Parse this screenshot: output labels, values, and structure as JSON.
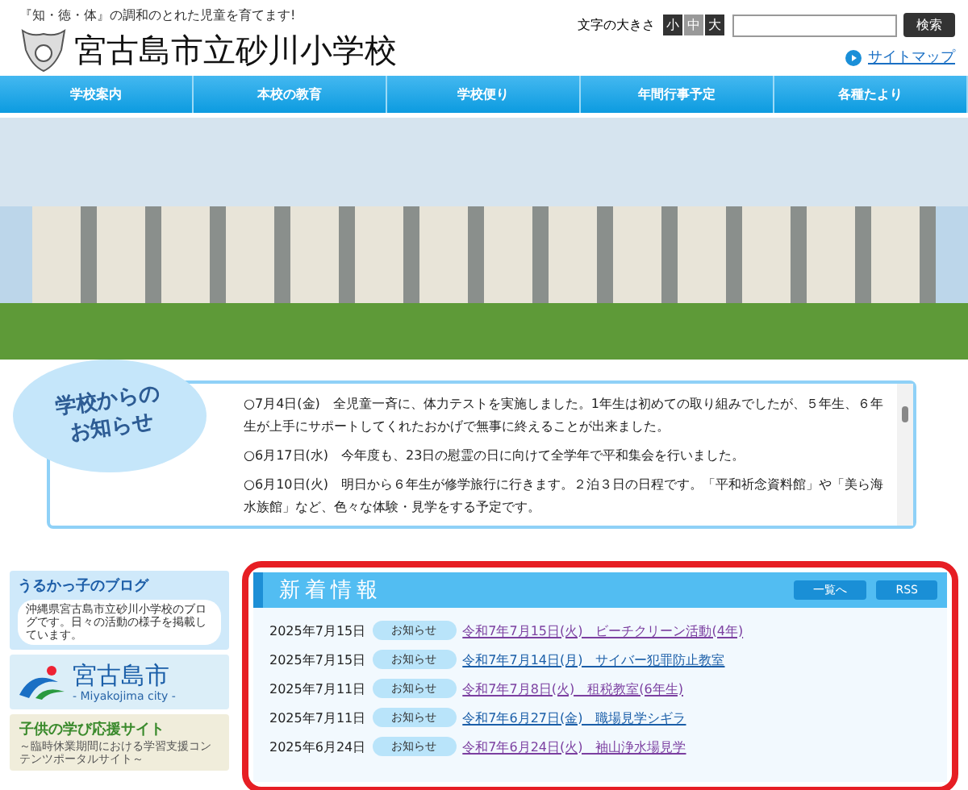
{
  "header": {
    "tagline": "『知・徳・体』の調和のとれた児童を育てます!",
    "school_name": "宮古島市立砂川小学校",
    "font_size_label": "文字の大きさ",
    "font_sizes": [
      {
        "label": "小",
        "selected": false
      },
      {
        "label": "中",
        "selected": true
      },
      {
        "label": "大",
        "selected": false
      }
    ],
    "search": {
      "button": "検索"
    },
    "sitemap": "サイトマップ"
  },
  "nav": [
    "学校案内",
    "本校の教育",
    "学校便り",
    "年間行事予定",
    "各種たより"
  ],
  "notices": {
    "title": "学校からのお知らせ",
    "items": [
      "○7月4日(金)　全児童一斉に、体力テストを実施しました。1年生は初めての取り組みでしたが、５年生、６年生が上手にサポートしてくれたおかげで無事に終えることが出来ました。",
      "○6月17日(水)　今年度も、23日の慰霊の日に向けて全学年で平和集会を行いました。",
      "○6月10日(火)　明日から６年生が修学旅行に行きます。２泊３日の日程です。「平和祈念資料館」や「美ら海水族館」など、色々な体験・見学をする予定です。"
    ]
  },
  "banners": [
    {
      "kind": "blog",
      "title": "うるかっ子のブログ",
      "text": "沖縄県宮古島市立砂川小学校のブログです。日々の活動の様子を掲載しています。"
    },
    {
      "kind": "city",
      "title": "宮古島市",
      "text": "- Miyakojima city -"
    },
    {
      "kind": "study",
      "title": "子供の学び応援サイト",
      "text": "～臨時休業期間における学習支援コンテンツポータルサイト～"
    }
  ],
  "news": {
    "title": "新着情報",
    "list_button": "一覧へ",
    "rss_button": "RSS",
    "items": [
      {
        "date": "2025年7月15日",
        "tag": "お知らせ",
        "title": "令和7年7月15日(火)　ビーチクリーン活動(4年)",
        "visited": true
      },
      {
        "date": "2025年7月15日",
        "tag": "お知らせ",
        "title": "令和7年7月14日(月)　サイバー犯罪防止教室",
        "visited": false
      },
      {
        "date": "2025年7月11日",
        "tag": "お知らせ",
        "title": "令和7年7月8日(火)　租税教室(6年生)",
        "visited": true
      },
      {
        "date": "2025年7月11日",
        "tag": "お知らせ",
        "title": "令和7年6月27日(金)　職場見学シギラ",
        "visited": false
      },
      {
        "date": "2025年6月24日",
        "tag": "お知らせ",
        "title": "令和7年6月24日(火)　袖山浄水場見学",
        "visited": true
      }
    ]
  }
}
